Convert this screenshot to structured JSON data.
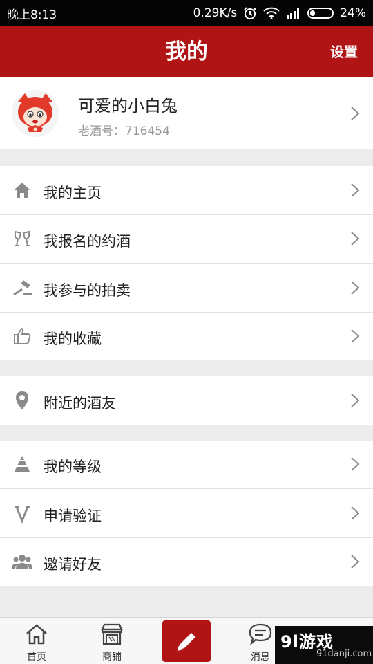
{
  "status_bar": {
    "time": "晚上8:13",
    "speed": "0.29K/s",
    "battery": "24%",
    "battery_fraction": 0.24
  },
  "header": {
    "title": "我的",
    "settings_label": "设置"
  },
  "profile": {
    "name": "可爱的小白兔",
    "id_text": "老酒号：716454"
  },
  "menu": {
    "group1": [
      {
        "label": "我的主页",
        "icon": "home-icon"
      },
      {
        "label": "我报名的约酒",
        "icon": "wine-glasses-icon"
      },
      {
        "label": "我参与的拍卖",
        "icon": "gavel-icon"
      },
      {
        "label": "我的收藏",
        "icon": "thumbs-up-icon"
      }
    ],
    "group2": [
      {
        "label": "附近的酒友",
        "icon": "location-pin-icon"
      }
    ],
    "group3": [
      {
        "label": "我的等级",
        "icon": "pyramid-icon"
      },
      {
        "label": "申请验证",
        "icon": "v-icon"
      },
      {
        "label": "邀请好友",
        "icon": "people-icon"
      }
    ]
  },
  "tabbar": {
    "home_label": "首页",
    "shop_label": "商铺",
    "message_label": "消息"
  },
  "watermark": {
    "main": "9l游戏",
    "sub": "91danji.com"
  },
  "colors": {
    "accent": "#b01414",
    "background": "#ececec",
    "icon_gray": "#8a8a8a"
  }
}
